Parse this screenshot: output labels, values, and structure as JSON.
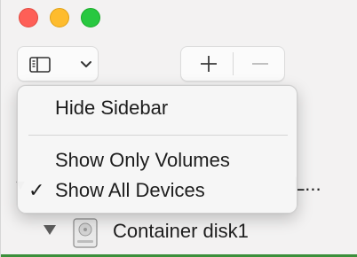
{
  "window": {
    "traffic_lights": [
      "close",
      "minimize",
      "zoom"
    ],
    "colors": {
      "close": "#fe5f57",
      "minimize": "#febc2e",
      "zoom": "#28c840"
    }
  },
  "toolbar": {
    "sidebar_button_icon": "sidebar-icon",
    "sidebar_dropdown_icon": "chevron-down-icon",
    "add_icon": "plus-icon",
    "remove_icon": "minus-icon"
  },
  "menu": {
    "items": [
      {
        "label": "Hide Sidebar",
        "checked": false
      },
      {
        "label": "Show Only Volumes",
        "checked": false
      },
      {
        "label": "Show All Devices",
        "checked": true
      }
    ],
    "checkmark": "✓"
  },
  "sidebar": {
    "partial_row_tail": "L...",
    "partial_row_triangle": "▼",
    "container_row": {
      "label": "Container disk1"
    }
  }
}
